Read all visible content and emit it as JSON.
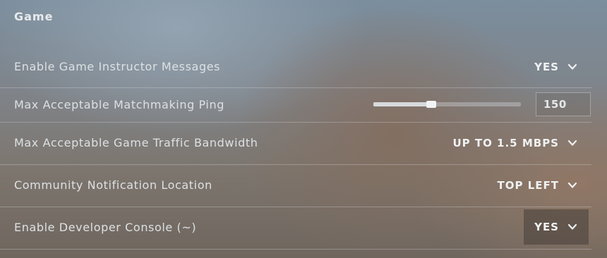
{
  "section": {
    "title": "Game"
  },
  "settings": [
    {
      "label": "Enable Game Instructor Messages",
      "type": "dropdown",
      "value": "YES"
    },
    {
      "label": "Max Acceptable Matchmaking Ping",
      "type": "slider",
      "value": "150",
      "slider_fraction": 0.39
    },
    {
      "label": "Max Acceptable Game Traffic Bandwidth",
      "type": "dropdown",
      "value": "UP TO 1.5 MBPS"
    },
    {
      "label": "Community Notification Location",
      "type": "dropdown",
      "value": "TOP LEFT"
    },
    {
      "label": "Enable Developer Console (~)",
      "type": "dropdown",
      "value": "YES",
      "state": "hovered"
    }
  ],
  "icons": {
    "dropdown_arrow": "chevron-down-icon"
  },
  "colors": {
    "text": "#dde0e3",
    "value_text": "#f0f1f2",
    "divider": "#dce0e4",
    "slider_fill": "#d8dadc"
  }
}
